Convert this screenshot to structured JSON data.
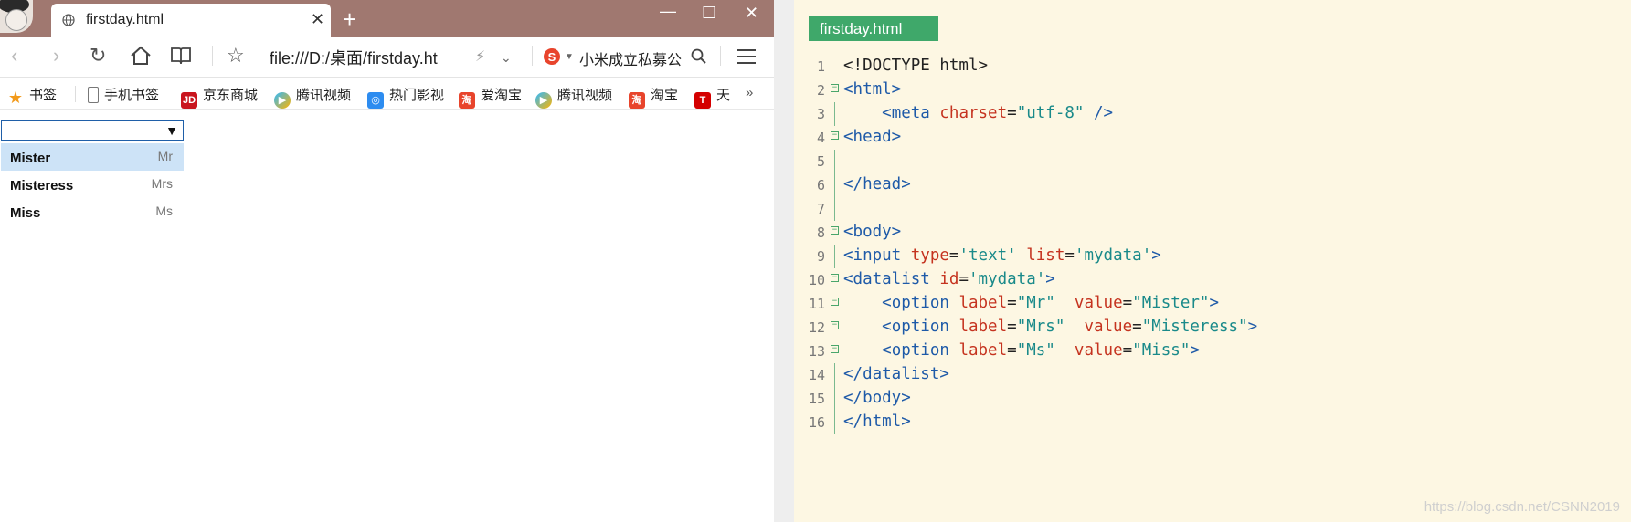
{
  "browser": {
    "tab_title": "firstday.html",
    "url": "file:///D:/桌面/firstday.ht",
    "search_text": "小米成立私募公",
    "bookmarks": [
      "书签",
      "手机书签",
      "京东商城",
      "腾讯视频",
      "热门影视",
      "爱淘宝",
      "腾讯视频",
      "淘宝",
      "天"
    ],
    "bookmark_more": "»",
    "datalist_input_value": "",
    "datalist_options": [
      {
        "value": "Mister",
        "label": "Mr",
        "selected": true
      },
      {
        "value": "Misteress",
        "label": "Mrs",
        "selected": false
      },
      {
        "value": "Miss",
        "label": "Ms",
        "selected": false
      }
    ]
  },
  "editor": {
    "file_tab": "firstday.html",
    "lines": [
      {
        "no": "1",
        "fold": false,
        "parts": [
          [
            "plain",
            "<!DOCTYPE html>"
          ]
        ]
      },
      {
        "no": "2",
        "fold": true,
        "parts": [
          [
            "tag",
            "<html>"
          ]
        ]
      },
      {
        "no": "3",
        "fold": false,
        "parts": [
          [
            "plain",
            "    "
          ],
          [
            "tag",
            "<meta "
          ],
          [
            "attr",
            "charset"
          ],
          [
            "plain",
            "="
          ],
          [
            "str",
            "\"utf-8\""
          ],
          [
            "tag",
            " />"
          ]
        ]
      },
      {
        "no": "4",
        "fold": true,
        "parts": [
          [
            "tag",
            "<head>"
          ]
        ]
      },
      {
        "no": "5",
        "fold": false,
        "parts": [
          [
            "plain",
            ""
          ]
        ]
      },
      {
        "no": "6",
        "fold": false,
        "parts": [
          [
            "tag",
            "</head>"
          ]
        ]
      },
      {
        "no": "7",
        "fold": false,
        "parts": [
          [
            "plain",
            ""
          ]
        ]
      },
      {
        "no": "8",
        "fold": true,
        "parts": [
          [
            "tag",
            "<body>"
          ]
        ]
      },
      {
        "no": "9",
        "fold": false,
        "parts": [
          [
            "tag",
            "<input "
          ],
          [
            "attr",
            "type"
          ],
          [
            "plain",
            "="
          ],
          [
            "str",
            "'text'"
          ],
          [
            "plain",
            " "
          ],
          [
            "attr",
            "list"
          ],
          [
            "plain",
            "="
          ],
          [
            "str",
            "'mydata'"
          ],
          [
            "tag",
            ">"
          ]
        ]
      },
      {
        "no": "10",
        "fold": true,
        "parts": [
          [
            "tag",
            "<datalist "
          ],
          [
            "attr",
            "id"
          ],
          [
            "plain",
            "="
          ],
          [
            "str",
            "'mydata'"
          ],
          [
            "tag",
            ">"
          ]
        ]
      },
      {
        "no": "11",
        "fold": true,
        "parts": [
          [
            "plain",
            "    "
          ],
          [
            "tag",
            "<option "
          ],
          [
            "attr",
            "label"
          ],
          [
            "plain",
            "="
          ],
          [
            "str",
            "\"Mr\""
          ],
          [
            "plain",
            "  "
          ],
          [
            "attr",
            "value"
          ],
          [
            "plain",
            "="
          ],
          [
            "str",
            "\"Mister\""
          ],
          [
            "tag",
            ">"
          ]
        ]
      },
      {
        "no": "12",
        "fold": true,
        "parts": [
          [
            "plain",
            "    "
          ],
          [
            "tag",
            "<option "
          ],
          [
            "attr",
            "label"
          ],
          [
            "plain",
            "="
          ],
          [
            "str",
            "\"Mrs\""
          ],
          [
            "plain",
            "  "
          ],
          [
            "attr",
            "value"
          ],
          [
            "plain",
            "="
          ],
          [
            "str",
            "\"Misteress\""
          ],
          [
            "tag",
            ">"
          ]
        ]
      },
      {
        "no": "13",
        "fold": true,
        "parts": [
          [
            "plain",
            "    "
          ],
          [
            "tag",
            "<option "
          ],
          [
            "attr",
            "label"
          ],
          [
            "plain",
            "="
          ],
          [
            "str",
            "\"Ms\""
          ],
          [
            "plain",
            "  "
          ],
          [
            "attr",
            "value"
          ],
          [
            "plain",
            "="
          ],
          [
            "str",
            "\"Miss\""
          ],
          [
            "tag",
            ">"
          ]
        ]
      },
      {
        "no": "14",
        "fold": false,
        "parts": [
          [
            "tag",
            "</datalist>"
          ]
        ]
      },
      {
        "no": "15",
        "fold": false,
        "parts": [
          [
            "tag",
            "</body>"
          ]
        ]
      },
      {
        "no": "16",
        "fold": false,
        "parts": [
          [
            "tag",
            "</html>"
          ]
        ]
      }
    ]
  },
  "watermark": "https://blog.csdn.net/CSNN2019"
}
